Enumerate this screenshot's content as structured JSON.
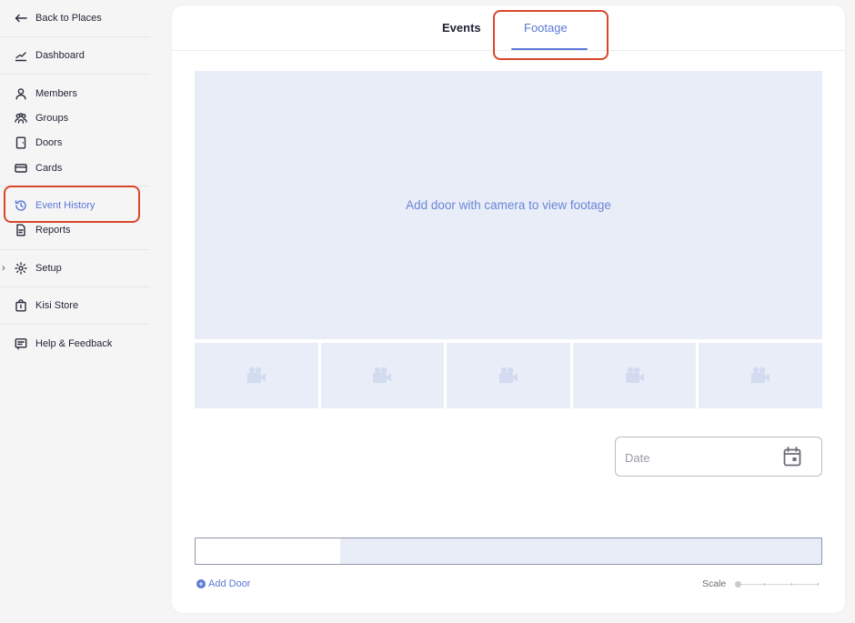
{
  "sidebar": {
    "back": "Back to Places",
    "items": [
      {
        "label": "Dashboard"
      },
      {
        "label": "Members"
      },
      {
        "label": "Groups"
      },
      {
        "label": "Doors"
      },
      {
        "label": "Cards"
      },
      {
        "label": "Event History"
      },
      {
        "label": "Reports"
      },
      {
        "label": "Setup"
      },
      {
        "label": "Kisi Store"
      },
      {
        "label": "Help & Feedback"
      }
    ],
    "active": "Event History"
  },
  "tabs": [
    {
      "label": "Events"
    },
    {
      "label": "Footage",
      "active": true
    }
  ],
  "footage": {
    "empty_message": "Add door with camera to view footage",
    "thumbnail_icon": "camera-icon"
  },
  "date_picker": {
    "placeholder": "Date",
    "value": ""
  },
  "timeline": {
    "add_door_label": "Add Door",
    "scale_label": "Scale"
  },
  "colors": {
    "accent": "#5a78d6",
    "highlight": "#d9472b",
    "placeholder_fill": "#e8edf8"
  }
}
